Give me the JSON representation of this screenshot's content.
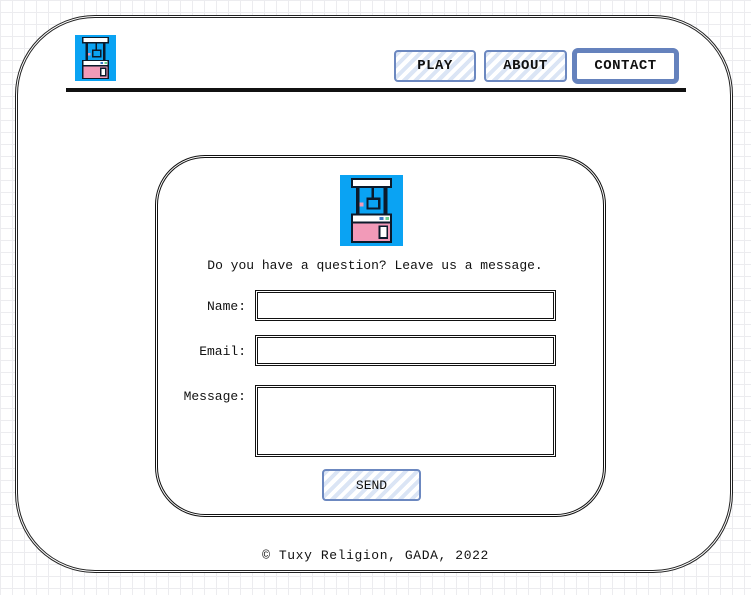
{
  "header": {
    "logo_icon": "claw-machine-icon",
    "nav": {
      "play_label": "PLAY",
      "about_label": "ABOUT",
      "contact_label": "CONTACT",
      "active": "CONTACT"
    }
  },
  "contact": {
    "logo_icon": "claw-machine-icon",
    "prompt": "Do you have a question? Leave us a message.",
    "name_label": "Name:",
    "name_value": "",
    "email_label": "Email:",
    "email_value": "",
    "message_label": "Message:",
    "message_value": "",
    "send_label": "SEND"
  },
  "footer": {
    "copyright": "© Tuxy Religion, GADA, 2022"
  },
  "colors": {
    "accent": "#6582bd",
    "button_hatch": "#dbe5f5",
    "logo_background": "#0aa3f3",
    "logo_pink": "#f29ab8",
    "logo_dark": "#0b1a2b"
  }
}
